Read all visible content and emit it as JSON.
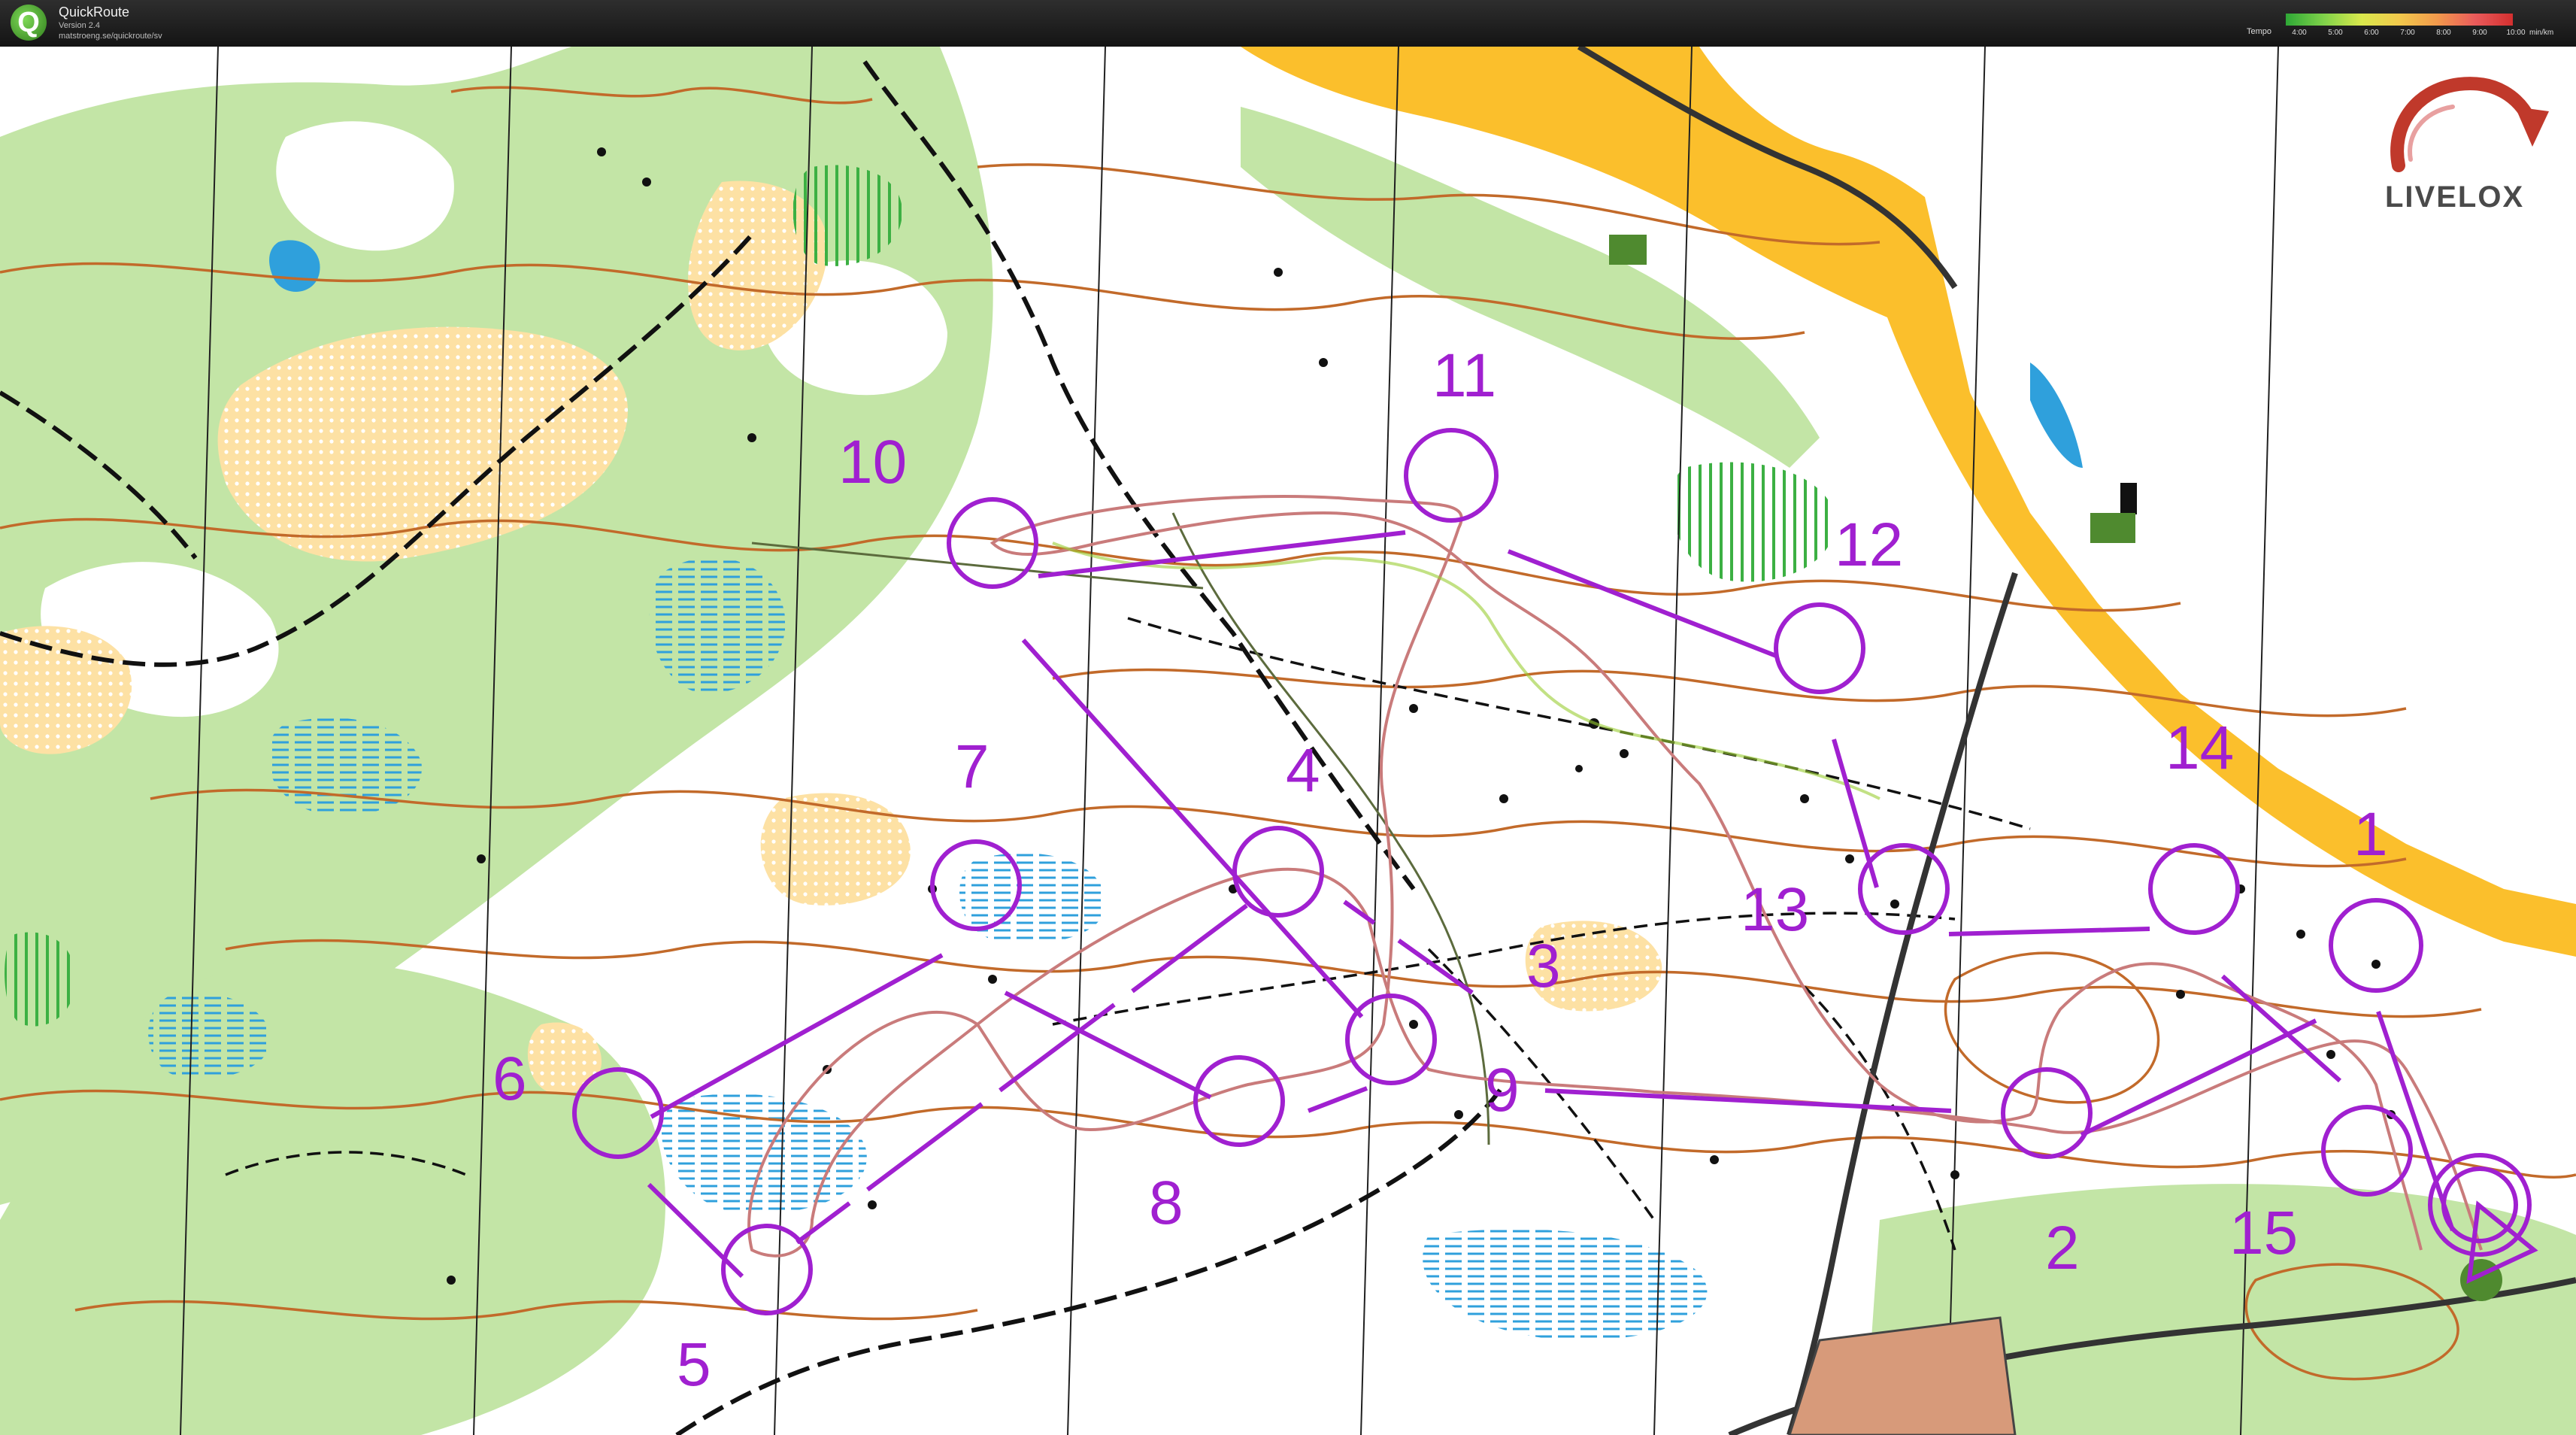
{
  "app": {
    "title": "QuickRoute",
    "version": "Version 2.4",
    "url": "matstroeng.se/quickroute/sv",
    "icon": "q-logo-icon"
  },
  "tempo": {
    "label": "Tempo",
    "ticks": [
      "4:00",
      "5:00",
      "6:00",
      "7:00",
      "8:00",
      "9:00",
      "10:00"
    ],
    "unit": "min/km"
  },
  "logo": {
    "text": "LIVELOX",
    "icon": "livelox-arrow-icon"
  },
  "colors": {
    "course": "#a020d0",
    "forest_green": "#c3e5a6",
    "open_yellow": "#fbbf2c",
    "rough_open": "#fde1a4",
    "water_blue": "#2fa0dc",
    "contour_brown": "#c26a2a",
    "route_line": "#c97b7b"
  },
  "controls": [
    {
      "label": "1"
    },
    {
      "label": "2"
    },
    {
      "label": "3"
    },
    {
      "label": "4"
    },
    {
      "label": "5"
    },
    {
      "label": "6"
    },
    {
      "label": "7"
    },
    {
      "label": "8"
    },
    {
      "label": "9"
    },
    {
      "label": "10"
    },
    {
      "label": "11"
    },
    {
      "label": "12"
    },
    {
      "label": "13"
    },
    {
      "label": "14"
    },
    {
      "label": "15"
    }
  ]
}
